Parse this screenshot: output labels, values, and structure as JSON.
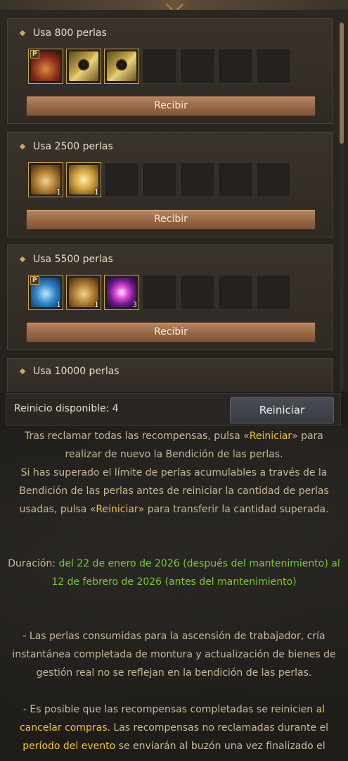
{
  "rewards": [
    {
      "title": "Usa 800 perlas",
      "button": "Recibir",
      "items": [
        {
          "icon": "red-treasure-chest-icon",
          "badge": "P",
          "count": ""
        },
        {
          "icon": "golden-ticket-icon",
          "badge": "",
          "count": ""
        },
        {
          "icon": "golden-ticket-icon",
          "badge": "",
          "count": ""
        }
      ]
    },
    {
      "title": "Usa 2500 perlas",
      "button": "Recibir",
      "items": [
        {
          "icon": "golden-treasure-chest-icon",
          "badge": "",
          "count": "1"
        },
        {
          "icon": "gold-gift-box-icon",
          "badge": "",
          "count": "1"
        }
      ]
    },
    {
      "title": "Usa 5500 perlas",
      "button": "Recibir",
      "items": [
        {
          "icon": "blue-treasure-chest-icon",
          "badge": "P",
          "count": "1"
        },
        {
          "icon": "golden-treasure-chest-icon",
          "badge": "",
          "count": "1"
        },
        {
          "icon": "purple-swirl-icon",
          "badge": "",
          "count": "3"
        }
      ]
    },
    {
      "title": "Usa 10000 perlas"
    }
  ],
  "reset": {
    "label": "Reinicio disponible: 4",
    "button": "Reiniciar"
  },
  "info": {
    "p1_a": "Tras reclamar todas las recompensas, pulsa «",
    "p1_hl": "Reiniciar",
    "p1_b": "» para realizar de nuevo la Bendición de las perlas.",
    "p2_a": "Si has superado el límite de perlas acumulables a través de la Bendición de las perlas antes de reiniciar la cantidad de perlas usadas, pulsa «",
    "p2_hl": "Reiniciar",
    "p2_b": "» para transferir la cantidad superada.",
    "duration_label": "Duración: ",
    "duration_value": "del 22 de enero de 2026 (después del mantenimiento) al 12 de febrero de 2026 (antes del mantenimiento)",
    "p3": "- Las perlas consumidas para la ascensión de trabajador, cría instantánea completada de montura y actualización de bienes de gestión real no se reflejan en la bendición de las perlas.",
    "p4_a": "- Es posible que las recompensas completadas se reinicien ",
    "p4_hl1": "al cancelar compras",
    "p4_b": ". Las recompensas no reclamadas durante el ",
    "p4_hl2": "período del evento",
    "p4_c": " se enviarán al buzón una vez finalizado el"
  },
  "colors": {
    "highlight": "#f2c230",
    "duration": "#6fcf2a",
    "receive_button": "#9a6a48",
    "reset_button": "#3a3c43"
  }
}
